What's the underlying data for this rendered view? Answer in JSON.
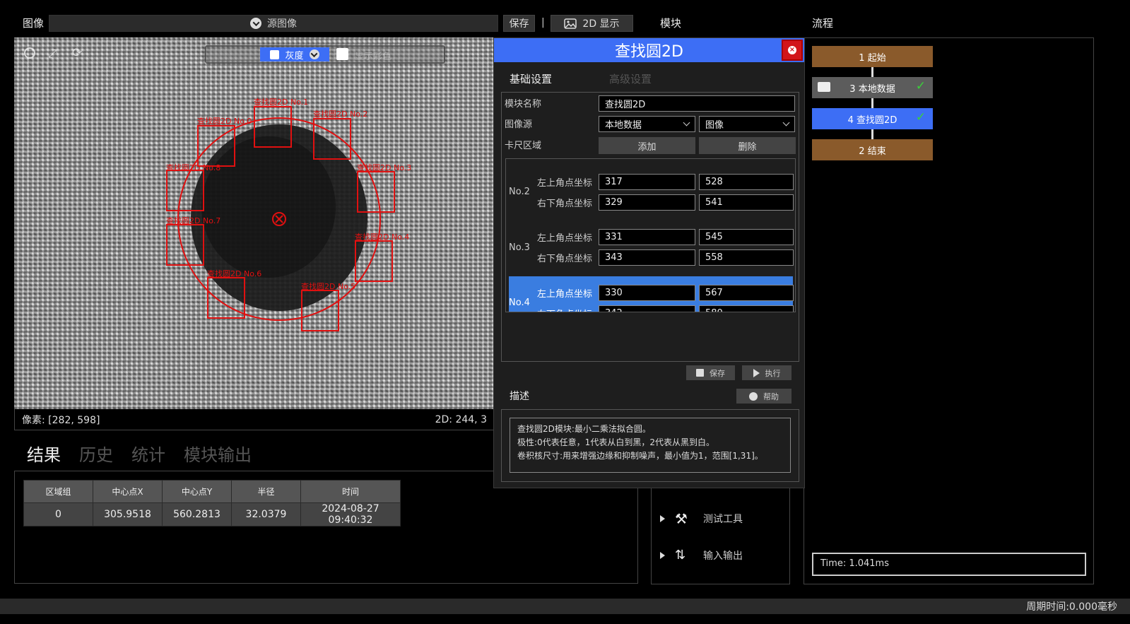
{
  "top": {
    "image_label": "图像",
    "source_label": "源图像",
    "save_label": "保存",
    "separator": "|",
    "display_label": "2D 显示",
    "module_label": "模块",
    "flow_label": "流程"
  },
  "image_overlay": {
    "mode_prefix": "灰度",
    "color_label": "灰度",
    "second_option": "显示彩色",
    "roi_labels": [
      "查找圆2D No.0",
      "查找圆2D No.1",
      "查找圆2D No.2",
      "查找圆2D No.3",
      "查找圆2D No.4",
      "查找圆2D No.5",
      "查找圆2D No.6",
      "查找圆2D No.7",
      "查找圆2D No.8"
    ]
  },
  "image_status": {
    "pixel": "像素: [282, 598]",
    "coord": "2D: 244, 3"
  },
  "results": {
    "tabs": [
      "结果",
      "历史",
      "统计",
      "模块输出"
    ],
    "active_tab": 0,
    "columns": [
      "区域组",
      "中心点X",
      "中心点Y",
      "半径",
      "时间"
    ],
    "rows": [
      [
        "0",
        "305.9518",
        "560.2813",
        "32.0379",
        "2024-08-27 09:40:32"
      ]
    ]
  },
  "modules": {
    "items": [
      {
        "label": "测试工具",
        "icon": "tools-icon"
      },
      {
        "label": "输入输出",
        "icon": "io-arrows-icon"
      }
    ]
  },
  "flow": {
    "nodes": [
      {
        "label": "1 起始",
        "color": "#8a5a2b"
      },
      {
        "label": "3 本地数据",
        "color": "#5c5c5c"
      },
      {
        "label": "4 查找圆2D",
        "color": "#3d6ef5"
      },
      {
        "label": "2 结束",
        "color": "#8a5a2b"
      }
    ],
    "time": "Time: 1.041ms"
  },
  "dialog": {
    "title": "查找圆2D",
    "tab_basic": "基础设置",
    "tab_advanced": "高级设置",
    "module_name_label": "模块名称",
    "module_name_value": "查找圆2D",
    "image_source_label": "图像源",
    "image_source_value1": "本地数据",
    "image_source_value2": "图像",
    "caliper_label": "卡尺区域",
    "add_label": "添加",
    "delete_label": "删除",
    "top_left_label": "左上角点坐标",
    "bottom_right_label": "右下角点坐标",
    "groups": [
      {
        "name": "No.2",
        "tl": [
          "317",
          "528"
        ],
        "br": [
          "329",
          "541"
        ]
      },
      {
        "name": "No.3",
        "tl": [
          "331",
          "545"
        ],
        "br": [
          "343",
          "558"
        ]
      },
      {
        "name": "No.4",
        "tl": [
          "330",
          "567"
        ],
        "br": [
          "342",
          "580"
        ]
      }
    ],
    "save_label": "保存",
    "run_label": "执行",
    "desc_label": "描述",
    "help_label": "帮助",
    "desc_lines": [
      "查找圆2D模块:最小二乘法拟合圆。",
      "极性:0代表任意，1代表从白到黑，2代表从黑到白。",
      "卷积核尺寸:用来增强边缘和抑制噪声，最小值为1，范围[1,31]。"
    ]
  },
  "statusbar": {
    "cycle_time": "周期时间:0.000毫秒"
  },
  "colors": {
    "accent": "#3d6ef5",
    "roi": "#e01010",
    "close": "#d2151a"
  }
}
